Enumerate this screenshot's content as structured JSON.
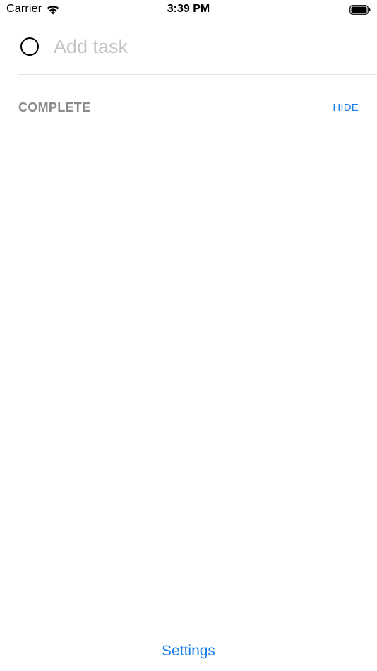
{
  "status_bar": {
    "carrier": "Carrier",
    "time": "3:39 PM",
    "wifi_icon": "wifi-icon",
    "battery_icon": "battery-icon"
  },
  "task_entry": {
    "placeholder": "Add task",
    "value": ""
  },
  "complete_section": {
    "title": "COMPLETE",
    "hide_label": "HIDE"
  },
  "footer": {
    "settings_label": "Settings"
  },
  "colors": {
    "accent": "#1a7ee8",
    "section_title": "#8a8a8e",
    "placeholder": "#c4c4c7",
    "divider": "#e3e3e6"
  }
}
